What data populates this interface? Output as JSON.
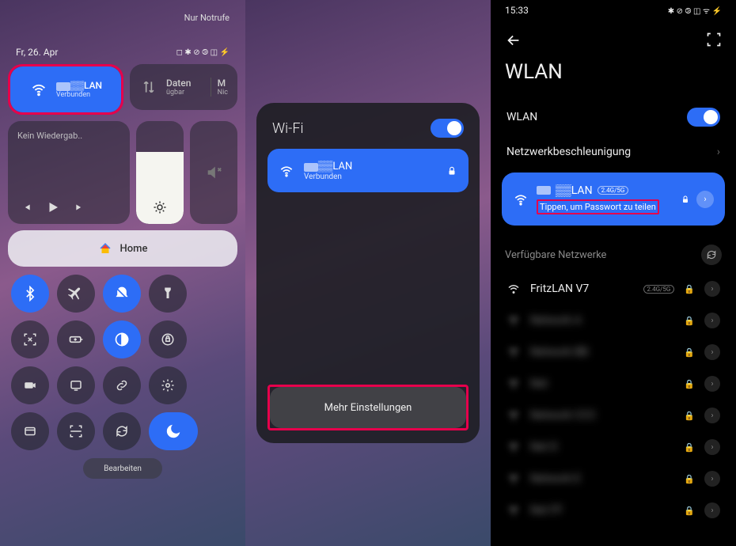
{
  "panel1": {
    "notrufe": "Nur Notrufe",
    "date": "Fr, 26. Apr",
    "wifi_tile": {
      "name": "▒▒LAN",
      "status": "Verbunden"
    },
    "data_tile": {
      "name": "Daten",
      "status": "ügbar"
    },
    "data_tile2": {
      "name": "M",
      "status": "Nic"
    },
    "media": "Kein Wiedergab..",
    "home": "Home",
    "edit": "Bearbeiten"
  },
  "panel2": {
    "title": "Wi-Fi",
    "net_name": "▒▒LAN",
    "net_status": "Verbunden",
    "more": "Mehr Einstellungen"
  },
  "panel3": {
    "time": "15:33",
    "title": "WLAN",
    "wlan_label": "WLAN",
    "accel_label": "Netzwerkbeschleunigung",
    "conn_name": "▒▒LAN",
    "band": "2.4G/5G",
    "hint": "Tippen, um Passwort zu teilen",
    "available": "Verfügbare Netzwerke",
    "net0": "FritzLAN V7",
    "net0_band": "2.4G/5G",
    "blurred": [
      "Network A",
      "Network BB",
      "Net",
      "Network CCC",
      "Net D",
      "Network E",
      "Net FF"
    ]
  }
}
